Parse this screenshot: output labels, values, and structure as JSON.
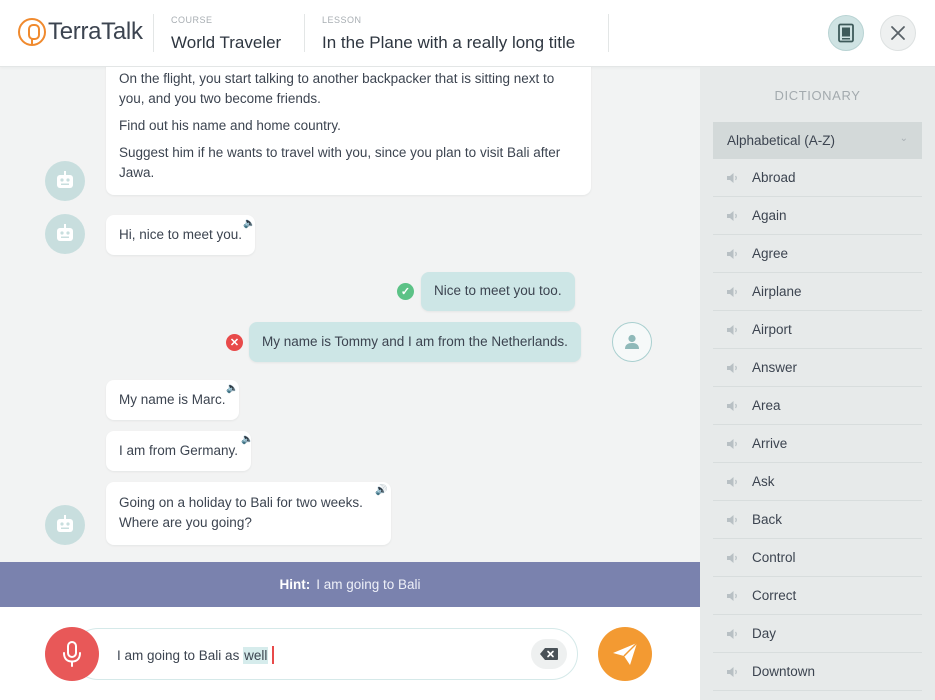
{
  "app": {
    "logo_text": "TerraTalk"
  },
  "header": {
    "course_kicker": "COURSE",
    "course_value": "World Traveler",
    "lesson_kicker": "LESSON",
    "lesson_value": "In the Plane with a really long title"
  },
  "chat": {
    "intro_lines": [
      "On the flight, you start talking to another backpacker that is sitting next to you, and you two become friends.",
      "Find out his name and home country.",
      "Suggest him if he wants to travel with you, since you plan to visit Bali after Jawa."
    ],
    "messages": [
      {
        "text": "Hi, nice to meet you."
      },
      {
        "text": "Nice to meet you too."
      },
      {
        "text": "My name is Tommy and I am from the Netherlands."
      },
      {
        "text": "My name is Marc."
      },
      {
        "text": "I am from Germany."
      },
      {
        "text": "Going on a holiday to Bali for two weeks. Where are you going?"
      }
    ]
  },
  "hint": {
    "label": "Hint:",
    "text": "I am going to Bali"
  },
  "composer": {
    "text_before": "I am going to Bali as ",
    "text_highlight": "well"
  },
  "dictionary": {
    "title": "DICTIONARY",
    "sort_label": "Alphabetical (A-Z)",
    "words": [
      "Abroad",
      "Again",
      "Agree",
      "Airplane",
      "Airport",
      "Answer",
      "Area",
      "Arrive",
      "Ask",
      "Back",
      "Control",
      "Correct",
      "Day",
      "Downtown"
    ]
  },
  "colors": {
    "accent_orange": "#f39a32",
    "mic_red": "#e85858",
    "hint_bar": "#7a82ae",
    "user_bubble": "#cde6e6",
    "success": "#5cc286",
    "error": "#e84a4a"
  },
  "icons": {
    "logo": "microphone-logo-icon",
    "dictionary": "book-icon",
    "close": "close-icon",
    "bot": "robot-icon",
    "user": "user-icon",
    "speaker": "speaker-icon",
    "mic": "microphone-icon",
    "clear": "backspace-icon",
    "send": "send-icon"
  }
}
